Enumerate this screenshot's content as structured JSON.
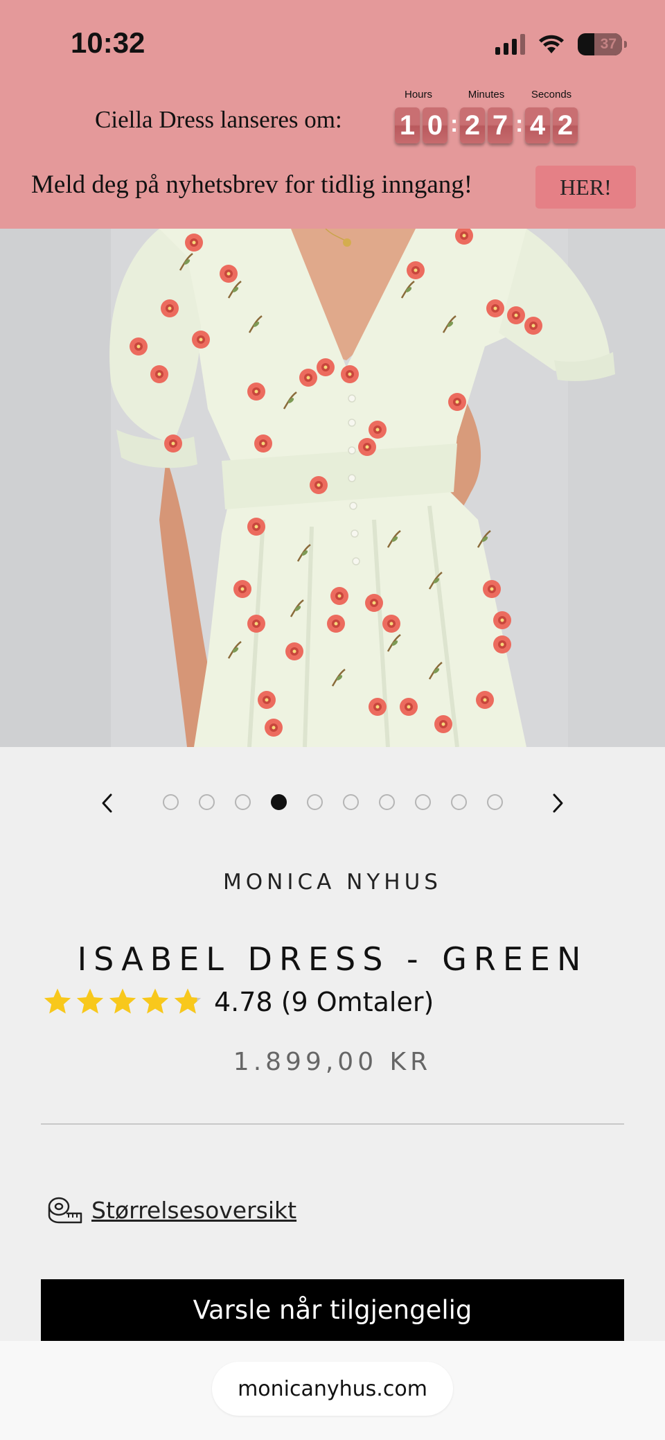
{
  "status_bar": {
    "time": "10:32",
    "battery": "37"
  },
  "promo": {
    "launch_text": "Ciella Dress lanseres om:",
    "countdown": {
      "labels": {
        "hours": "Hours",
        "minutes": "Minutes",
        "seconds": "Seconds"
      },
      "digits": [
        "1",
        "0",
        "2",
        "7",
        "4",
        "2"
      ]
    },
    "newsletter_text": "Meld deg på nyhetsbrev for tidlig inngang!",
    "cta_label": "HER!"
  },
  "carousel": {
    "total_images": 10,
    "active_index": 4
  },
  "product": {
    "brand": "MONICA NYHUS",
    "title": "ISABEL DRESS - GREEN",
    "rating": {
      "value": 4.78,
      "text": "4.78 (9 Omtaler)"
    },
    "price": "1.899,00 KR",
    "size_guide_label": "Størrelsesoversikt",
    "notify_label": "Varsle når tilgjengelig"
  },
  "browser": {
    "url": "monicanyhus.com"
  },
  "colors": {
    "promo_bg": "#e4999a",
    "her_button": "#e58086",
    "star": "#f8c81c",
    "countdown_digit": "#c96f72"
  }
}
